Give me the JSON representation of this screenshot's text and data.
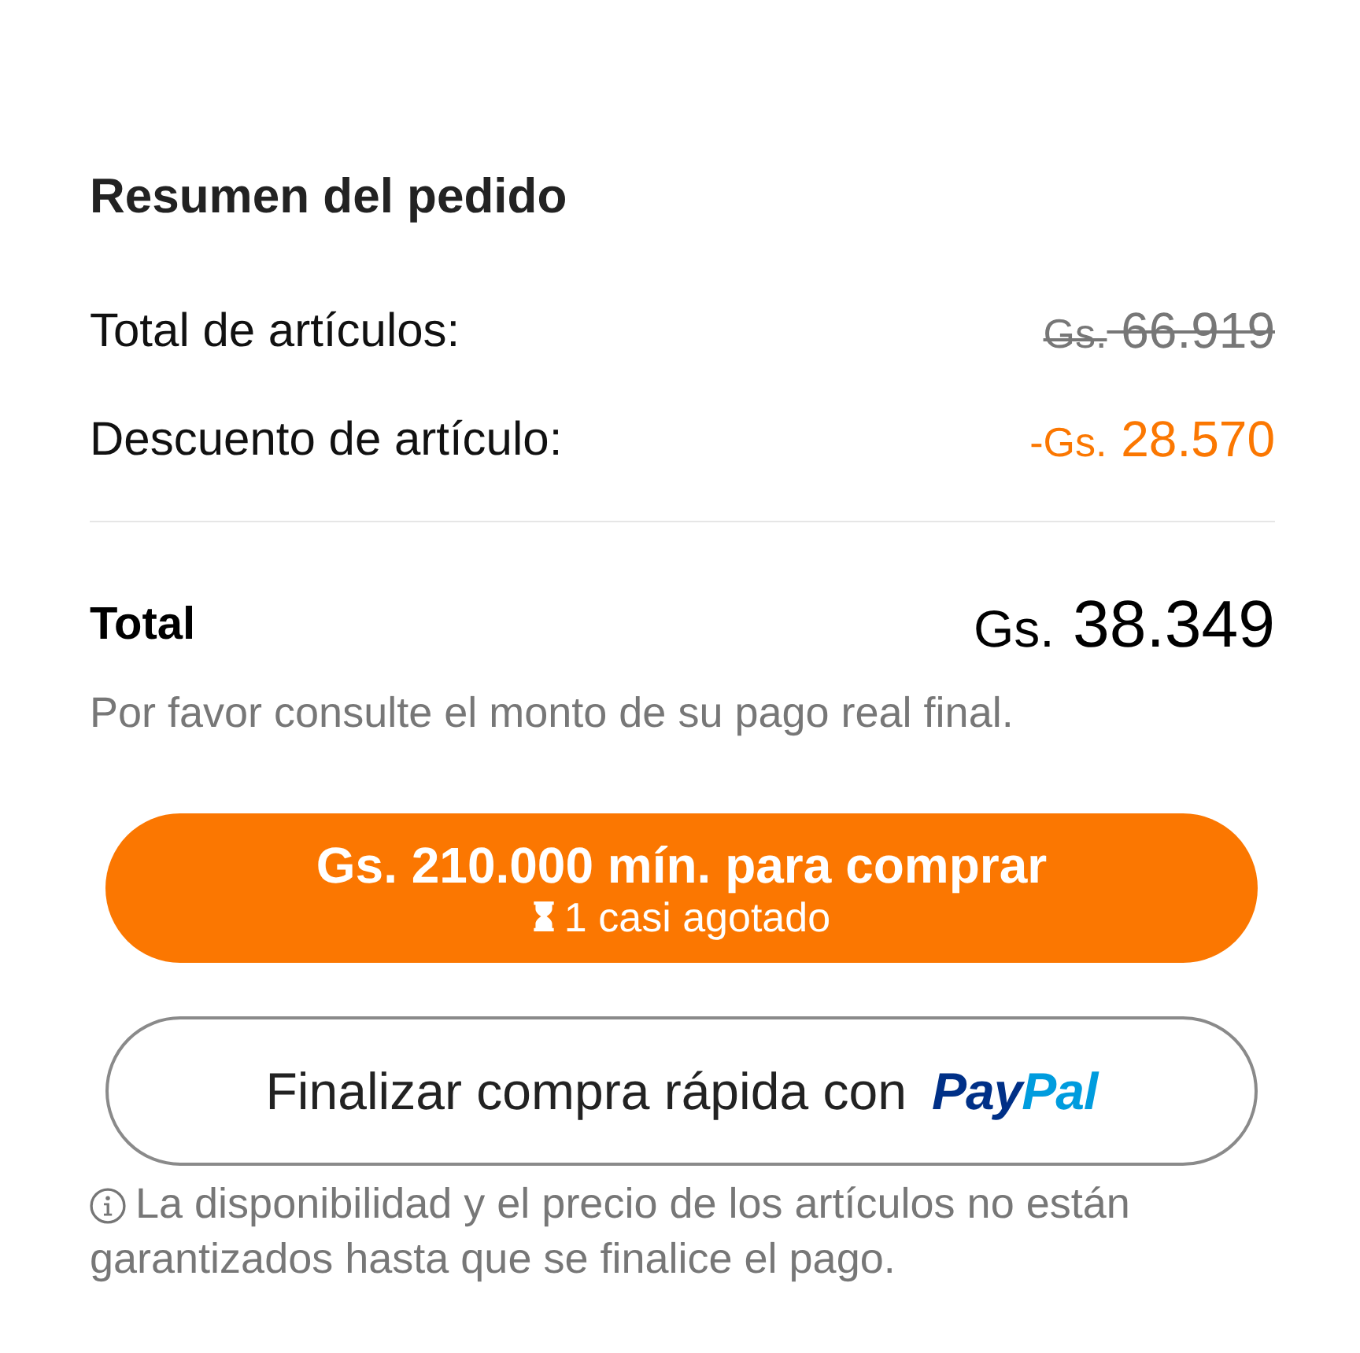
{
  "summary": {
    "title": "Resumen del pedido",
    "lines": [
      {
        "label": "Total de artículos:",
        "currency": "Gs.",
        "amount": "66.919",
        "kind": "struck"
      },
      {
        "label": "Descuento de artículo:",
        "currency": "-Gs.",
        "amount": "28.570",
        "kind": "discount"
      }
    ],
    "total": {
      "label": "Total",
      "currency": "Gs.",
      "amount": "38.349"
    },
    "note": "Por favor consulte el monto de su pago real final."
  },
  "checkout_button": {
    "label": "Gs. 210.000 mín. para comprar",
    "sublabel": "1 casi agotado"
  },
  "express_button": {
    "label": "Finalizar compra rápida con",
    "logo_parts": [
      "Pay",
      "Pal"
    ]
  },
  "disclaimer": "La disponibilidad y el precio de los artículos no están garantizados hasta que se finalice el pago."
}
